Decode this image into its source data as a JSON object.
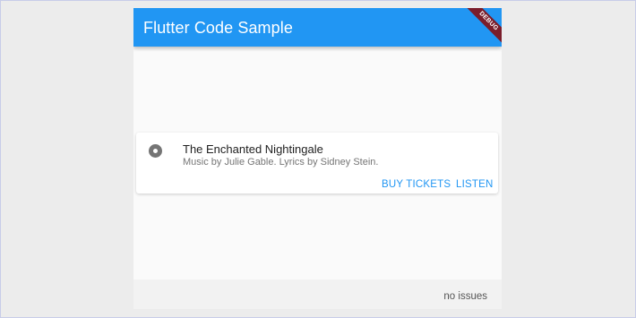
{
  "appbar": {
    "title": "Flutter Code Sample",
    "debug_banner": "DEBUG",
    "color": "#2196f3"
  },
  "card": {
    "title": "The Enchanted Nightingale",
    "subtitle": "Music by Julie Gable. Lyrics by Sidney Stein.",
    "buttons": {
      "buy_tickets": "BUY TICKETS",
      "listen": "LISTEN"
    },
    "leading_icon": "radio-button-icon"
  },
  "footer": {
    "status": "no issues"
  }
}
